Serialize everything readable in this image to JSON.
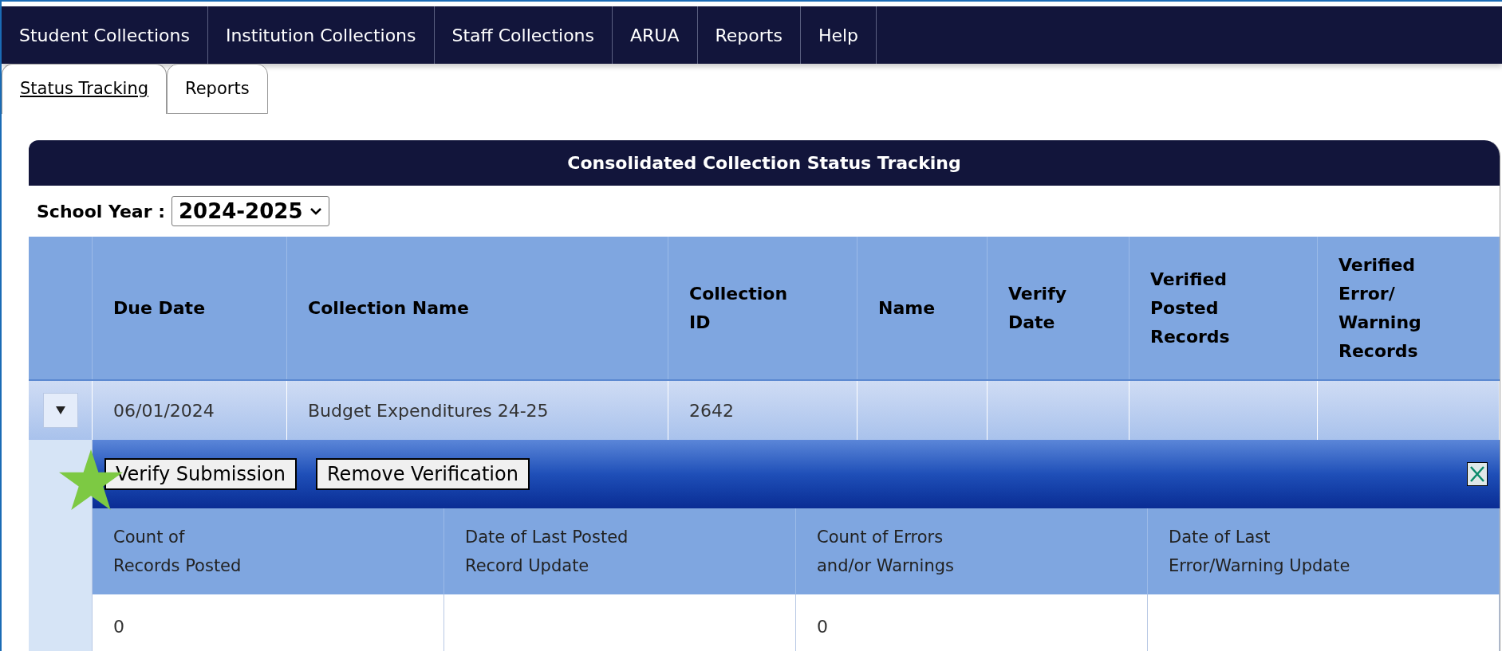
{
  "nav": [
    {
      "label": "Student Collections"
    },
    {
      "label": "Institution Collections"
    },
    {
      "label": "Staff Collections"
    },
    {
      "label": "ARUA"
    },
    {
      "label": "Reports"
    },
    {
      "label": "Help"
    }
  ],
  "tabs": [
    {
      "label": "Status Tracking",
      "selected": true
    },
    {
      "label": "Reports",
      "selected": false
    }
  ],
  "panel": {
    "title": "Consolidated Collection Status Tracking",
    "school_year": {
      "label": "School Year :",
      "value": "2024-2025"
    }
  },
  "table": {
    "columns": [
      "Due Date",
      "Collection Name",
      "Collection ID",
      "Name",
      "Verify Date",
      "Verified Posted Records",
      "Verified Error/ Warning Records"
    ],
    "rows": [
      {
        "expanded": true,
        "cells": [
          "06/01/2024",
          "Budget Expenditures 24-25",
          "2642",
          null,
          null,
          null,
          null
        ],
        "detail": {
          "buttons": [
            "Verify Submission",
            "Remove Verification"
          ],
          "columns": [
            {
              "header": "Count of Records Posted",
              "value": "0"
            },
            {
              "header": "Date of Last Posted Record Update"
            },
            {
              "header": "Count of Errors and/or Warnings",
              "value": "0"
            },
            {
              "header": "Date of Last Error/Warning Update"
            }
          ]
        }
      }
    ]
  }
}
